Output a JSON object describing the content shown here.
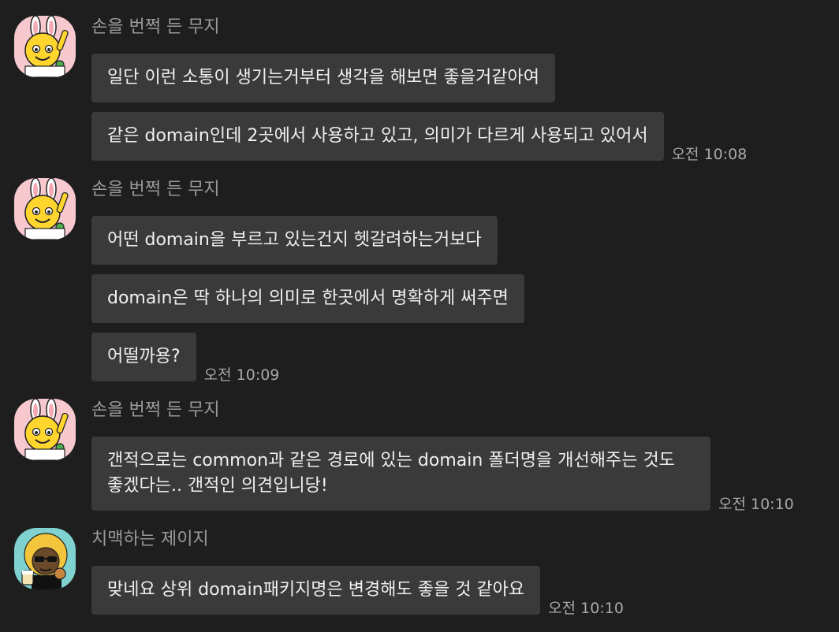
{
  "messages": [
    {
      "sender": "손을 번쩍 든 무지",
      "avatar_icon": "muzi-raised-hand-avatar",
      "lines": [
        "일단 이런 소통이 생기는거부터 생각을 해보면 좋을거같아여",
        "같은 domain인데 2곳에서 사용하고 있고, 의미가 다르게 사용되고 있어서"
      ],
      "time": "오전 10:08"
    },
    {
      "sender": "손을 번쩍 든 무지",
      "avatar_icon": "muzi-raised-hand-avatar",
      "lines": [
        "어떤 domain을 부르고 있는건지 헷갈려하는거보다",
        "domain은 딱 하나의 의미로 한곳에서 명확하게 써주면",
        "어떨까용?"
      ],
      "time": "오전 10:09"
    },
    {
      "sender": "손을 번쩍 든 무지",
      "avatar_icon": "muzi-raised-hand-avatar",
      "lines": [
        "갠적으로는 common과 같은 경로에 있는 domain 폴더명을 개선해주는 것도 좋겠다는.. 갠적인 의견입니당!"
      ],
      "time": "오전 10:10"
    },
    {
      "sender": "치맥하는 제이지",
      "avatar_icon": "jayg-chimaek-avatar",
      "lines": [
        "맞네요 상위 domain패키지명은 변경해도 좋을 것 같아요"
      ],
      "time": "오전 10:10"
    }
  ],
  "colors": {
    "background": "#1e1e1e",
    "bubble": "#3a3a3a",
    "sender_text": "#9a9a9a",
    "time_text": "#a8a8a8",
    "message_text": "#f0f0f0"
  }
}
